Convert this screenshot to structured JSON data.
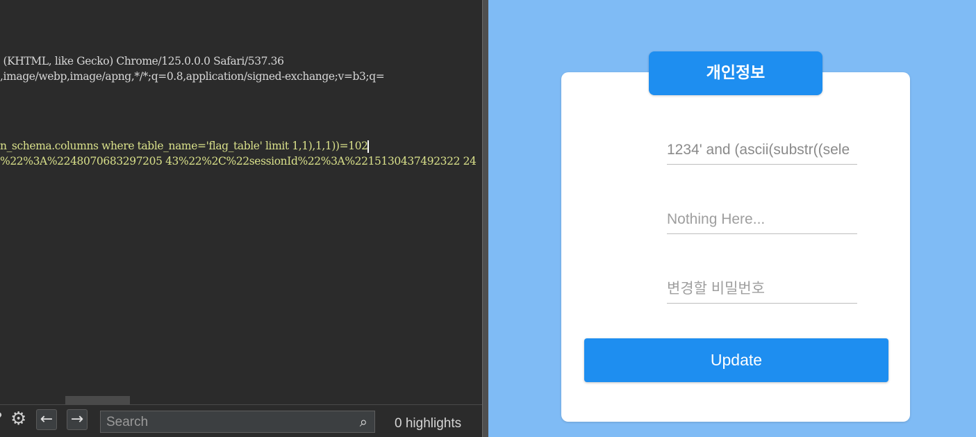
{
  "editor": {
    "lines": [
      " (KHTML, like Gecko) Chrome/125.0.0.0 Safari/537.36",
      ",image/webp,image/apng,*/*;q=0.8,application/signed-exchange;v=b3;q=",
      "n_schema.columns where table_name='flag_table' limit 1,1),1,1))=102",
      "%22%3A%2248070683297205 43%22%2C%22sessionId%22%3A%2215130437492322 24"
    ],
    "search": {
      "placeholder": "Search",
      "value": ""
    },
    "highlights_text": "0 highlights",
    "icons": {
      "settings": "gear-icon",
      "prev": "arrow-left-icon",
      "next": "arrow-right-icon",
      "search": "search-icon"
    }
  },
  "form": {
    "title": "개인정보",
    "fields": [
      {
        "value": "1234' and (ascii(substr((sele",
        "placeholder": ""
      },
      {
        "value": "",
        "placeholder": "Nothing Here..."
      },
      {
        "value": "",
        "placeholder": "변경할 비밀번호"
      }
    ],
    "update_label": "Update"
  },
  "colors": {
    "page_bg": "#7fbbf5",
    "accent": "#1e8ef0",
    "editor_bg": "#2b2b2b",
    "highlight_text": "#d9e08a"
  }
}
